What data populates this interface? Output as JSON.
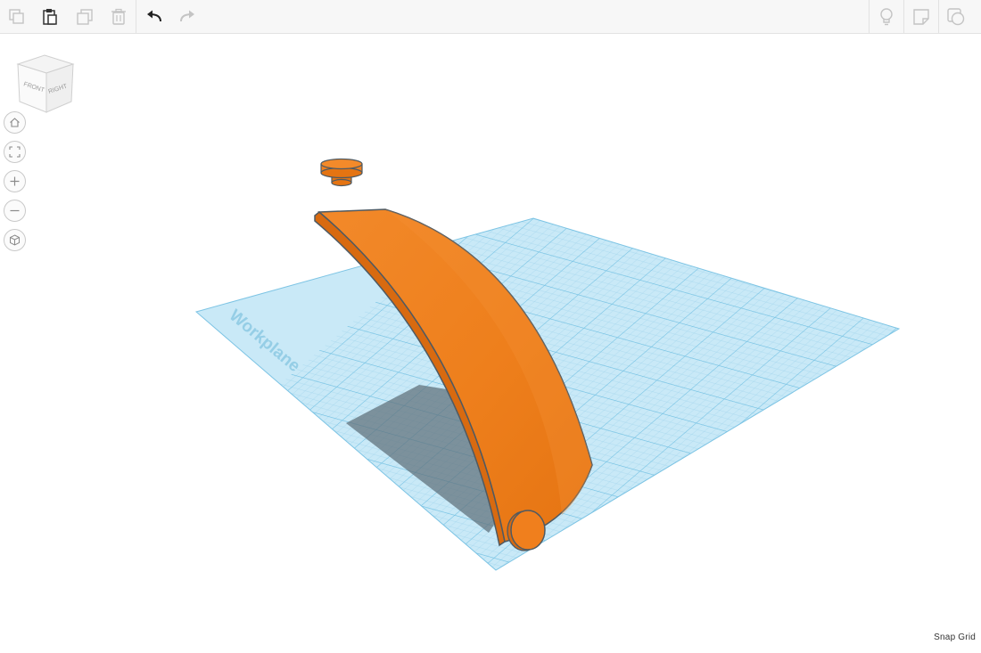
{
  "toolbar": {
    "left_actions": [
      {
        "name": "copy-icon"
      },
      {
        "name": "paste-icon"
      },
      {
        "name": "duplicate-icon"
      },
      {
        "name": "delete-icon"
      },
      {
        "name": "undo-icon"
      },
      {
        "name": "redo-icon"
      }
    ],
    "right_actions": [
      {
        "name": "lightbulb-icon"
      },
      {
        "name": "shape-notes-icon"
      },
      {
        "name": "show-all-icon"
      }
    ]
  },
  "view_cube": {
    "front_label": "FRONT",
    "right_label": "RIGHT"
  },
  "nav_controls": [
    {
      "name": "home-icon"
    },
    {
      "name": "fit-view-icon"
    },
    {
      "name": "zoom-in-icon"
    },
    {
      "name": "zoom-out-icon"
    },
    {
      "name": "perspective-icon"
    }
  ],
  "workplane": {
    "label": "Workplane",
    "color": "#bfe4f4",
    "grid_color": "#7fc6e6"
  },
  "shape": {
    "color": "#f07f1d"
  },
  "status": {
    "snap_grid_label": "Snap Grid"
  }
}
